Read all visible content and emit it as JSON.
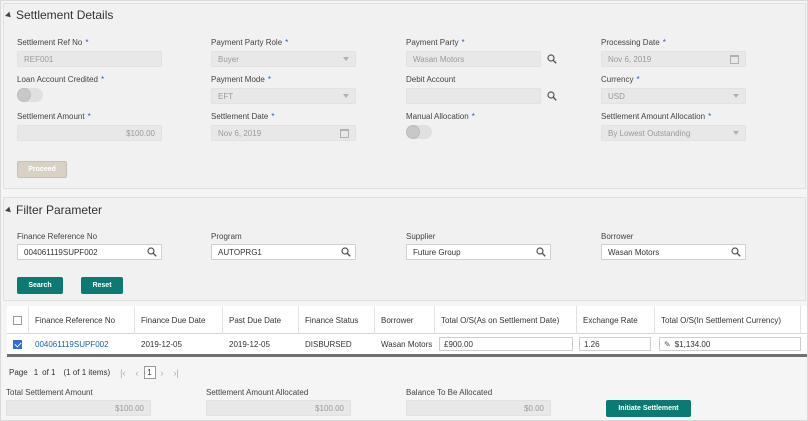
{
  "settlement": {
    "title": "Settlement Details",
    "ref_no_label": "Settlement Ref No",
    "ref_no_value": "REF001",
    "party_role_label": "Payment Party Role",
    "party_role_value": "Buyer",
    "party_label": "Payment Party",
    "party_value": "Wasan Motors",
    "processing_date_label": "Processing Date",
    "processing_date_value": "Nov 6, 2019",
    "loan_credited_label": "Loan Account Credited",
    "mode_label": "Payment Mode",
    "mode_value": "EFT",
    "debit_label": "Debit Account",
    "debit_value": "",
    "currency_label": "Currency",
    "currency_value": "USD",
    "amount_label": "Settlement Amount",
    "amount_value": "$100.00",
    "date_label": "Settlement Date",
    "date_value": "Nov 6, 2019",
    "manual_label": "Manual Allocation",
    "alloc_label": "Settlement Amount Allocation",
    "alloc_value": "By Lowest Outstanding",
    "proceed_label": "Proceed",
    "required_mark": "*"
  },
  "filter": {
    "title": "Filter Parameter",
    "finance_ref_label": "Finance Reference No",
    "finance_ref_value": "004061119SUPF002",
    "program_label": "Program",
    "program_value": "AUTOPRG1",
    "supplier_label": "Supplier",
    "supplier_value": "Future Group",
    "borrower_label": "Borrower",
    "borrower_value": "Wasan Motors",
    "search_label": "Search",
    "reset_label": "Reset"
  },
  "table": {
    "columns": [
      "Finance Reference No",
      "Finance Due Date",
      "Past Due Date",
      "Finance Status",
      "Borrower",
      "Total O/S(As on Settlement Date)",
      "Exchange Rate",
      "Total O/S(In Settlement Currency)",
      "I"
    ],
    "rows": [
      {
        "ref": "004061119SUPF002",
        "due": "2019-12-05",
        "past_due": "2019-12-05",
        "status": "DISBURSED",
        "borrower": "Wasan Motors",
        "total_os": "£900.00",
        "rate": "1.26",
        "total_settle": "$1,134.00"
      }
    ]
  },
  "pager": {
    "page_label": "Page",
    "page_value": "1",
    "of_label": "of 1",
    "items": "(1 of 1 items)",
    "current": "1"
  },
  "footer": {
    "total_label": "Total Settlement Amount",
    "total_value": "$100.00",
    "allocated_label": "Settlement Amount Allocated",
    "allocated_value": "$100.00",
    "balance_label": "Balance To Be Allocated",
    "balance_value": "$0.00",
    "initiate_label": "Initiate Settlement"
  },
  "colors": {
    "accent": "#0a7a73",
    "link": "#1a5fb4",
    "required": "#1a5fb4"
  }
}
